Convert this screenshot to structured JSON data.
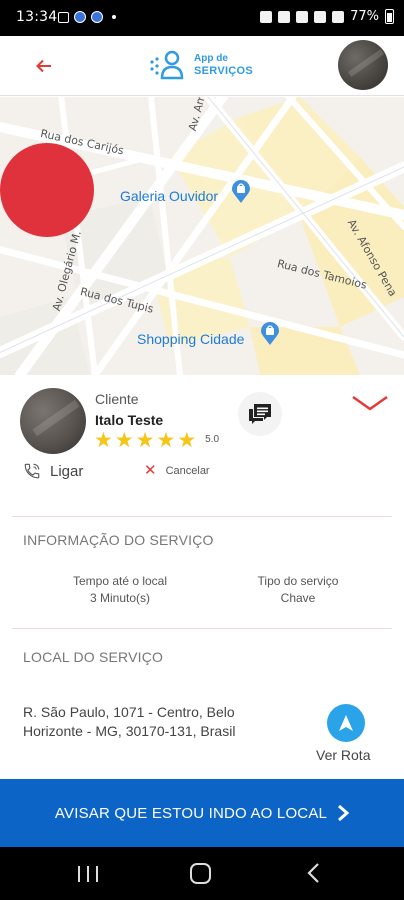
{
  "status_bar": {
    "time": "13:34",
    "battery": "77%"
  },
  "header": {
    "logo_line1": "App de",
    "logo_line2": "SERVIÇOS"
  },
  "map": {
    "streets": [
      "Rua dos Carijós",
      "Av. Amazonas",
      "Av. Olegário M.",
      "Rua dos Tupis",
      "Rua dos Tamoios",
      "Av. Afonso Pena"
    ],
    "pois": [
      "Galeria Ouvidor",
      "Shopping Cidade"
    ]
  },
  "client": {
    "role": "Cliente",
    "name": "Italo Teste",
    "stars": 5,
    "rating": "5.0",
    "call_label": "Ligar",
    "cancel_label": "Cancelar"
  },
  "service_info": {
    "title": "INFORMAÇÃO DO SERVIÇO",
    "time_label": "Tempo até o local",
    "time_value": "3 Minuto(s)",
    "type_label": "Tipo do serviço",
    "type_value": "Chave"
  },
  "location": {
    "title": "LOCAL DO SERVIÇO",
    "address_line1": "R. São Paulo, 1071 - Centro, Belo",
    "address_line2": "Horizonte - MG, 30170-131, Brasil",
    "route_label": "Ver Rota"
  },
  "cta": {
    "label": "AVISAR QUE ESTOU INDO AO LOCAL"
  },
  "colors": {
    "accent_red": "#e53935",
    "marker_red": "#e0323c",
    "primary_blue": "#0d64c7",
    "nav_blue": "#2aa3e8",
    "star_yellow": "#f5c518"
  }
}
